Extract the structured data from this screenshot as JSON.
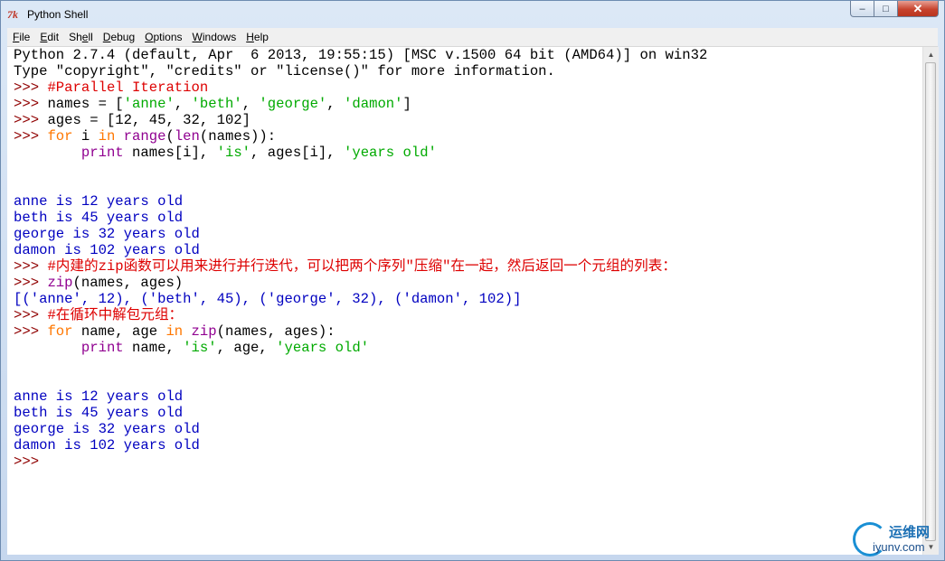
{
  "window": {
    "title": "Python Shell",
    "icon_text": "7k",
    "controls": {
      "minimize": "‒",
      "maximize": "□",
      "close": "✕"
    }
  },
  "menu": [
    {
      "underline": "F",
      "rest": "ile"
    },
    {
      "underline": "E",
      "rest": "dit"
    },
    {
      "underline": "",
      "rest": "Shell",
      "mid_u": "e"
    },
    {
      "underline": "D",
      "rest": "ebug"
    },
    {
      "underline": "O",
      "rest": "ptions"
    },
    {
      "underline": "W",
      "rest": "indows"
    },
    {
      "underline": "H",
      "rest": "elp"
    }
  ],
  "shell_lines": [
    [
      {
        "t": "t",
        "v": "Python 2.7.4 (default, Apr  6 2013, 19:55:15) [MSC v.1500 64 bit (AMD64)] on win32"
      }
    ],
    [
      {
        "t": "t",
        "v": "Type \"copyright\", \"credits\" or \"license()\" for more information."
      }
    ],
    [
      {
        "t": "p",
        "v": ">>> "
      },
      {
        "t": "c",
        "v": "#Parallel Iteration"
      }
    ],
    [
      {
        "t": "p",
        "v": ">>> "
      },
      {
        "t": "t",
        "v": "names = ["
      },
      {
        "t": "s",
        "v": "'anne'"
      },
      {
        "t": "t",
        "v": ", "
      },
      {
        "t": "s",
        "v": "'beth'"
      },
      {
        "t": "t",
        "v": ", "
      },
      {
        "t": "s",
        "v": "'george'"
      },
      {
        "t": "t",
        "v": ", "
      },
      {
        "t": "s",
        "v": "'damon'"
      },
      {
        "t": "t",
        "v": "]"
      }
    ],
    [
      {
        "t": "p",
        "v": ">>> "
      },
      {
        "t": "t",
        "v": "ages = [12, 45, 32, 102]"
      }
    ],
    [
      {
        "t": "p",
        "v": ">>> "
      },
      {
        "t": "k",
        "v": "for"
      },
      {
        "t": "t",
        "v": " i "
      },
      {
        "t": "k",
        "v": "in"
      },
      {
        "t": "t",
        "v": " "
      },
      {
        "t": "b",
        "v": "range"
      },
      {
        "t": "t",
        "v": "("
      },
      {
        "t": "b",
        "v": "len"
      },
      {
        "t": "t",
        "v": "(names)):"
      }
    ],
    [
      {
        "t": "t",
        "v": "        "
      },
      {
        "t": "b",
        "v": "print"
      },
      {
        "t": "t",
        "v": " names[i], "
      },
      {
        "t": "s",
        "v": "'is'"
      },
      {
        "t": "t",
        "v": ", ages[i], "
      },
      {
        "t": "s",
        "v": "'years old'"
      }
    ],
    [],
    [],
    [
      {
        "t": "o",
        "v": "anne is 12 years old"
      }
    ],
    [
      {
        "t": "o",
        "v": "beth is 45 years old"
      }
    ],
    [
      {
        "t": "o",
        "v": "george is 32 years old"
      }
    ],
    [
      {
        "t": "o",
        "v": "damon is 102 years old"
      }
    ],
    [
      {
        "t": "p",
        "v": ">>> "
      },
      {
        "t": "c",
        "v": "#内建的zip函数可以用来进行并行迭代，可以把两个序列\"压缩\"在一起，然后返回一个元组的列表："
      }
    ],
    [
      {
        "t": "p",
        "v": ">>> "
      },
      {
        "t": "b",
        "v": "zip"
      },
      {
        "t": "t",
        "v": "(names, ages)"
      }
    ],
    [
      {
        "t": "o",
        "v": "[('anne', 12), ('beth', 45), ('george', 32), ('damon', 102)]"
      }
    ],
    [
      {
        "t": "p",
        "v": ">>> "
      },
      {
        "t": "c",
        "v": "#在循环中解包元组："
      }
    ],
    [
      {
        "t": "p",
        "v": ">>> "
      },
      {
        "t": "k",
        "v": "for"
      },
      {
        "t": "t",
        "v": " name, age "
      },
      {
        "t": "k",
        "v": "in"
      },
      {
        "t": "t",
        "v": " "
      },
      {
        "t": "b",
        "v": "zip"
      },
      {
        "t": "t",
        "v": "(names, ages):"
      }
    ],
    [
      {
        "t": "t",
        "v": "        "
      },
      {
        "t": "b",
        "v": "print"
      },
      {
        "t": "t",
        "v": " name, "
      },
      {
        "t": "s",
        "v": "'is'"
      },
      {
        "t": "t",
        "v": ", age, "
      },
      {
        "t": "s",
        "v": "'years old'"
      }
    ],
    [],
    [],
    [
      {
        "t": "o",
        "v": "anne is 12 years old"
      }
    ],
    [
      {
        "t": "o",
        "v": "beth is 45 years old"
      }
    ],
    [
      {
        "t": "o",
        "v": "george is 32 years old"
      }
    ],
    [
      {
        "t": "o",
        "v": "damon is 102 years old"
      }
    ],
    [
      {
        "t": "p",
        "v": ">>> "
      }
    ]
  ],
  "watermark": {
    "cn": "运维网",
    "url": "iyunv.com"
  },
  "colors": {
    "prompt": "#900000",
    "keyword": "#ff7700",
    "string": "#00aa00",
    "builtin": "#900090",
    "comment": "#dd0000",
    "output": "#0000c0"
  }
}
